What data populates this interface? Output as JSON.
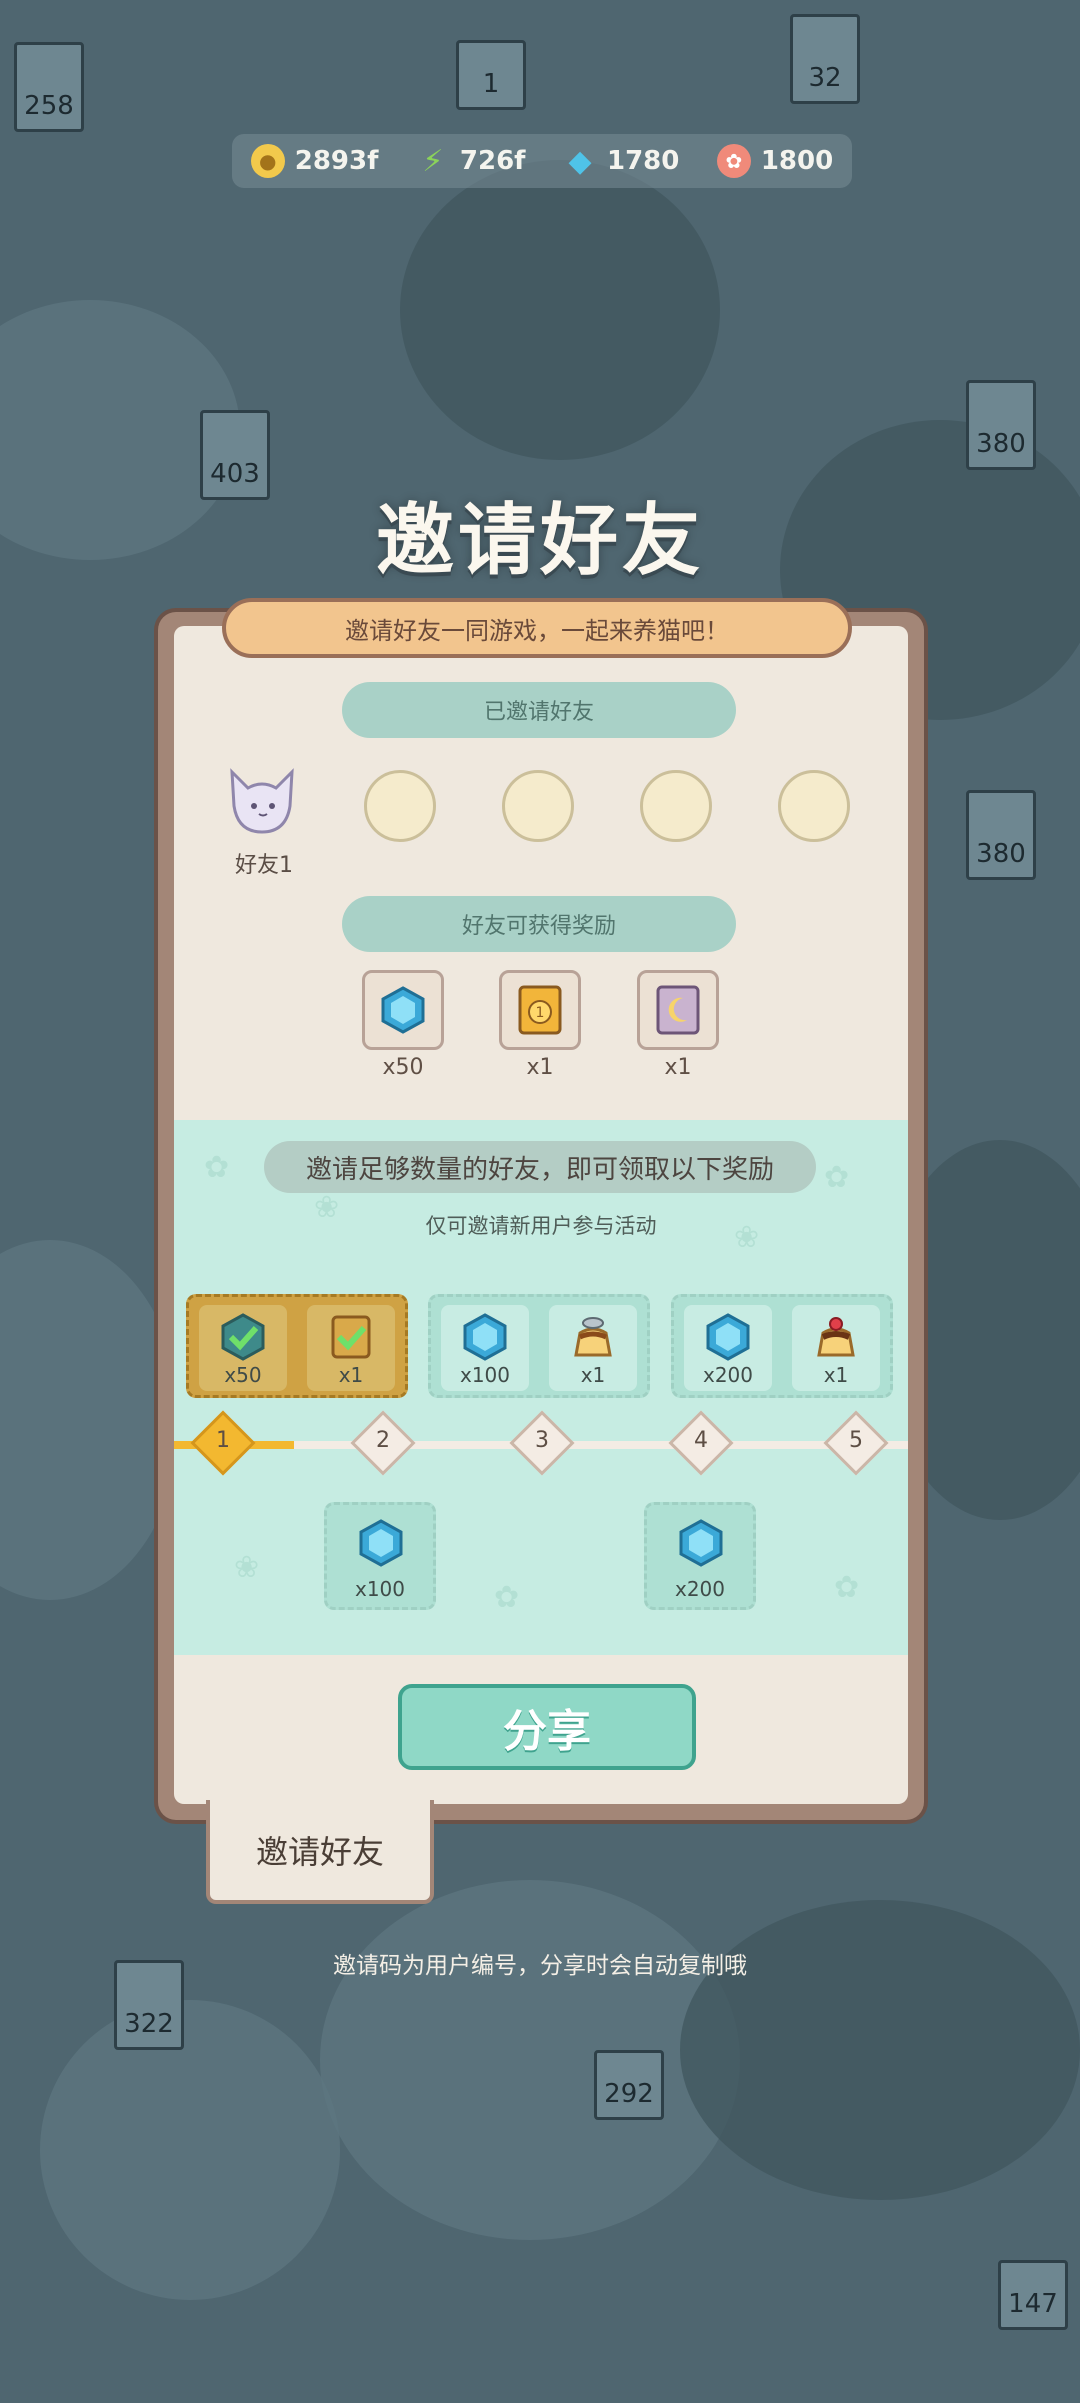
{
  "currencies": [
    {
      "name": "coin",
      "value": "2893f",
      "icon": "coin-icon",
      "color": "#f2c94c"
    },
    {
      "name": "energy",
      "value": "726f",
      "icon": "lightning-icon",
      "color": "#8bd35a"
    },
    {
      "name": "gem",
      "value": "1780",
      "icon": "gem-icon",
      "color": "#4fc3e8"
    },
    {
      "name": "shell",
      "value": "1800",
      "icon": "shell-icon",
      "color": "#f08a7a"
    }
  ],
  "background": {
    "signs": [
      "258",
      "32",
      "403",
      "380",
      "380",
      "322",
      "292",
      "147",
      "1"
    ]
  },
  "page_title": "邀请好友",
  "banner": "邀请好友一同游戏，一起来养猫吧！",
  "invited_section": {
    "title": "已邀请好友",
    "friends": [
      {
        "label": "好友1",
        "filled": true
      },
      {
        "label": "",
        "filled": false
      },
      {
        "label": "",
        "filled": false
      },
      {
        "label": "",
        "filled": false
      },
      {
        "label": "",
        "filled": false
      }
    ]
  },
  "friend_reward_section": {
    "title": "好友可获得奖励",
    "rewards": [
      {
        "icon": "gem-icon",
        "qty": "x50"
      },
      {
        "icon": "ticket-icon",
        "qty": "x1"
      },
      {
        "icon": "moon-card-icon",
        "qty": "x1"
      }
    ]
  },
  "milestone_section": {
    "notice": "邀请足够数量的好友，即可领取以下奖励",
    "subnote": "仅可邀请新用户参与活动",
    "tiers": [
      {
        "milestone": 1,
        "claimed": true,
        "items": [
          {
            "icon": "gem-icon",
            "qty": "x50"
          },
          {
            "icon": "ticket-icon",
            "qty": "x1"
          }
        ]
      },
      {
        "milestone": 3,
        "claimed": false,
        "items": [
          {
            "icon": "gem-icon",
            "qty": "x100"
          },
          {
            "icon": "fish-pudding-icon",
            "qty": "x1"
          }
        ]
      },
      {
        "milestone": 5,
        "claimed": false,
        "items": [
          {
            "icon": "gem-icon",
            "qty": "x200"
          },
          {
            "icon": "cherry-pudding-icon",
            "qty": "x1"
          }
        ]
      }
    ],
    "track_nodes": [
      "1",
      "2",
      "3",
      "4",
      "5"
    ],
    "current_progress": 1,
    "bottom_rewards": [
      {
        "milestone": 2,
        "icon": "gem-icon",
        "qty": "x100"
      },
      {
        "milestone": 4,
        "icon": "gem-icon",
        "qty": "x200"
      }
    ]
  },
  "share_button": "分享",
  "bottom_tab": "邀请好友",
  "footer_hint": "邀请码为用户编号，分享时会自动复制哦"
}
